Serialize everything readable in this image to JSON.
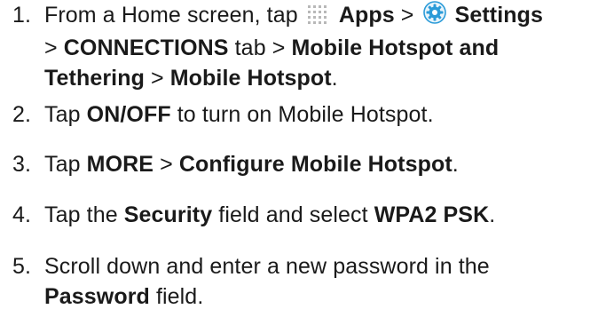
{
  "steps": [
    {
      "number": "1.",
      "parts": {
        "a": "From a Home screen, tap ",
        "apps": "Apps",
        "sep1": " > ",
        "settings": "Settings",
        "sep2": " > ",
        "connections": "CONNECTIONS",
        "tab": " tab > ",
        "hotspot_tethering": "Mobile Hotspot and Tethering",
        "sep3": " > ",
        "mobile_hotspot": "Mobile Hotspot",
        "end": "."
      },
      "icons": {
        "apps": "apps-grid-icon",
        "settings": "settings-gear-icon"
      }
    },
    {
      "number": "2.",
      "parts": {
        "a": "Tap ",
        "b": "ON/OFF",
        "c": " to turn on Mobile Hotspot."
      }
    },
    {
      "number": "3.",
      "parts": {
        "a": "Tap ",
        "b": "MORE",
        "c": " > ",
        "d": "Configure Mobile Hotspot",
        "e": "."
      }
    },
    {
      "number": "4.",
      "parts": {
        "a": "Tap the ",
        "b": "Security",
        "c": " field and select ",
        "d": "WPA2 PSK",
        "e": "."
      }
    },
    {
      "number": "5.",
      "parts": {
        "a": "Scroll down and enter a new password in the ",
        "b": "Password",
        "c": " field."
      }
    }
  ],
  "colors": {
    "text": "#1a1a1a",
    "apps_icon": "#b8b8b8",
    "settings_icon_outer": "#2b9bd8",
    "settings_icon_inner": "#ffffff"
  }
}
